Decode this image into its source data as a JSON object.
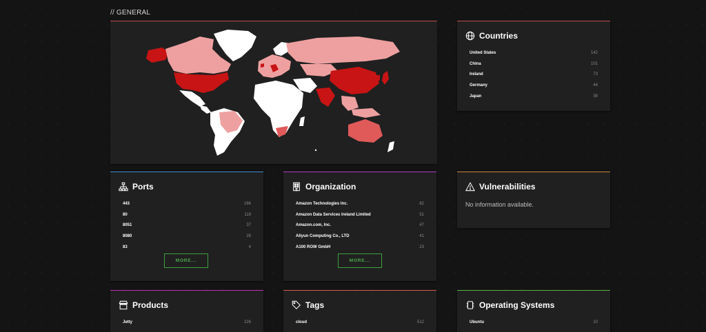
{
  "general": {
    "title": "// GENERAL"
  },
  "countries": {
    "title": "Countries",
    "items": [
      {
        "name": "United States",
        "count": "142"
      },
      {
        "name": "China",
        "count": "101"
      },
      {
        "name": "Ireland",
        "count": "73"
      },
      {
        "name": "Germany",
        "count": "44"
      },
      {
        "name": "Japan",
        "count": "38"
      }
    ]
  },
  "ports": {
    "title": "Ports",
    "items": [
      {
        "name": "443",
        "count": "166"
      },
      {
        "name": "80",
        "count": "119"
      },
      {
        "name": "8051",
        "count": "37"
      },
      {
        "name": "8080",
        "count": "28"
      },
      {
        "name": "83",
        "count": "4"
      }
    ],
    "more_label": "MORE..."
  },
  "organization": {
    "title": "Organization",
    "items": [
      {
        "name": "Amazon Technologies Inc.",
        "count": "82"
      },
      {
        "name": "Amazon Data Services Ireland Limited",
        "count": "51"
      },
      {
        "name": "Amazon.com, Inc.",
        "count": "47"
      },
      {
        "name": "Aliyun Computing Co., LTD",
        "count": "41"
      },
      {
        "name": "A100 ROW GmbH",
        "count": "23"
      }
    ],
    "more_label": "MORE..."
  },
  "vulnerabilities": {
    "title": "Vulnerabilities",
    "message": "No information available."
  },
  "products": {
    "title": "Products",
    "items": [
      {
        "name": "Jetty",
        "count": "226"
      }
    ]
  },
  "tags": {
    "title": "Tags",
    "items": [
      {
        "name": "cloud",
        "count": "512"
      }
    ]
  },
  "operating_systems": {
    "title": "Operating Systems",
    "items": [
      {
        "name": "Ubuntu",
        "count": "10"
      }
    ]
  },
  "colors": {
    "map_high": "#c81414",
    "map_mid": "#e05a5a",
    "map_low": "#eea0a0",
    "map_none": "#ffffff",
    "accent_green": "#4cae4c"
  }
}
